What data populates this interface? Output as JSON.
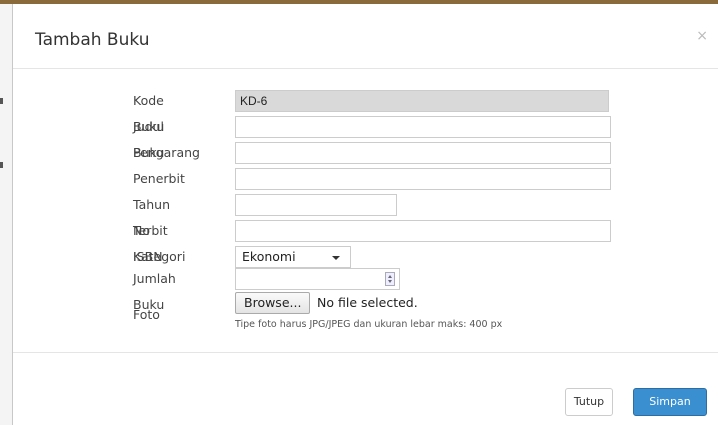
{
  "modal": {
    "title": "Tambah Buku",
    "close_icon": "close-icon",
    "close_glyph": "×"
  },
  "form": {
    "kode_buku": {
      "label": "Kode Buku",
      "value": "KD-6"
    },
    "judul_buku": {
      "label": "Judul Buku",
      "value": ""
    },
    "pengarang": {
      "label": "Pengarang",
      "value": ""
    },
    "penerbit": {
      "label": "Penerbit",
      "value": ""
    },
    "tahun_terbit": {
      "label": "Tahun Terbit",
      "value": ""
    },
    "no_isbn": {
      "label": "No ISBN",
      "value": ""
    },
    "kategori": {
      "label": "Kategori",
      "selected": "Ekonomi"
    },
    "jumlah_buku": {
      "label": "Jumlah Buku",
      "value": ""
    },
    "foto": {
      "label": "Foto",
      "browse_label": "Browse...",
      "file_status": "No file selected.",
      "hint": "Tipe foto harus JPG/JPEG dan ukuran lebar maks: 400 px"
    }
  },
  "footer": {
    "tutup_label": "Tutup",
    "simpan_label": "Simpan"
  },
  "colors": {
    "primary": "#3a8fd0",
    "readonly_bg": "#d9d9d9",
    "frame_top": "#8a6a3a"
  }
}
